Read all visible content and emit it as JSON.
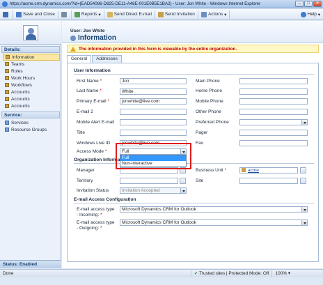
{
  "window": {
    "title": "https://acme.crm.dynamics.com/?id={EAD54086-D825-DE11-A48E-001E0B5E1BA2} - User: Jon White - Windows Internet Explorer",
    "btn_min": "–",
    "btn_max": "□",
    "btn_close": "✕"
  },
  "toolbar": {
    "save_close": "Save and Close",
    "reports": "Reports",
    "send_email": "Send Direct E-mail",
    "send_invite": "Send Invitation",
    "actions": "Actions",
    "help": "Help"
  },
  "nav": {
    "details_header": "Details:",
    "items": [
      "Information",
      "Teams",
      "Roles",
      "Work Hours",
      "Workflows",
      "Accounts",
      "Accounts",
      "Accounts"
    ],
    "service_header": "Service:",
    "service_items": [
      "Services",
      "Resource Groups"
    ],
    "status": "Status: Enabled"
  },
  "header": {
    "user_label": "User: Jon White",
    "title": "Information",
    "notice": "The information provided in this form is viewable by the entire organization."
  },
  "tabs": [
    "General",
    "Addresses"
  ],
  "sections": {
    "user_info": "User Information",
    "org_info": "Organization Information",
    "email_config": "E-mail Access Configuration"
  },
  "fields": {
    "first_name": {
      "label": "First Name",
      "value": "Jon"
    },
    "last_name": {
      "label": "Last Name",
      "value": "White"
    },
    "primary_email": {
      "label": "Primary E-mail",
      "value": "jonwhite@live.com"
    },
    "email2": {
      "label": "E-mail 2",
      "value": ""
    },
    "mobile_alert": {
      "label": "Mobile Alert E-mail",
      "value": ""
    },
    "title": {
      "label": "Title",
      "value": ""
    },
    "live_id": {
      "label": "Windows Live ID",
      "value": "jonwhite@live.com"
    },
    "access_mode": {
      "label": "Access Mode",
      "value": "Full",
      "options": [
        "Full",
        "Non-interactive"
      ]
    },
    "main_phone": {
      "label": "Main Phone",
      "value": ""
    },
    "home_phone": {
      "label": "Home Phone",
      "value": ""
    },
    "mobile_phone": {
      "label": "Mobile Phone",
      "value": ""
    },
    "other_phone": {
      "label": "Other Phone",
      "value": ""
    },
    "preferred_phone": {
      "label": "Preferred Phone",
      "value": ""
    },
    "pager": {
      "label": "Pager",
      "value": ""
    },
    "fax": {
      "label": "Fax",
      "value": ""
    },
    "manager": {
      "label": "Manager",
      "value": ""
    },
    "territory": {
      "label": "Territory",
      "value": ""
    },
    "invitation_status": {
      "label": "Invitation Status",
      "value": "Invitation Accepted"
    },
    "business_unit": {
      "label": "Business Unit",
      "value": "acme"
    },
    "site": {
      "label": "Site",
      "value": ""
    },
    "incoming": {
      "label": "E-mail access type - Incoming:",
      "value": "Microsoft Dynamics CRM for Outlook"
    },
    "outgoing": {
      "label": "E-mail access type - Outgoing:",
      "value": "Microsoft Dynamics CRM for Outlook"
    }
  },
  "statusbar": {
    "left": "Done",
    "zone": "Trusted sites | Protected Mode: Off",
    "zoom": "100%"
  }
}
